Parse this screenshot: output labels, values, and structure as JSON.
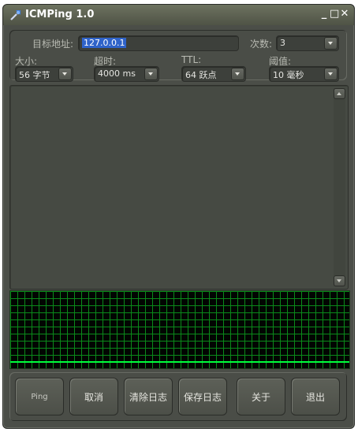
{
  "window": {
    "title": "ICMPing 1.0"
  },
  "titlebar": {
    "minimize": "_",
    "maximize": "□",
    "close": "✕"
  },
  "settings": {
    "target_label": "目标地址:",
    "target_value": "127.0.0.1",
    "count_label": "次数:",
    "count_value": "3",
    "size_label": "大小:",
    "size_value": "56 字节",
    "timeout_label": "超时:",
    "timeout_value": "4000 ms",
    "ttl_label": "TTL:",
    "ttl_value": "64 跃点",
    "threshold_label": "阈值:",
    "threshold_value": "10 毫秒"
  },
  "buttons": {
    "ping": "Ping",
    "cancel": "取消",
    "clear_log": "清除日志",
    "save_log": "保存日志",
    "about": "关于",
    "exit": "退出"
  },
  "colors": {
    "grid": "#0a8a1a",
    "graph_line": "#00ff3c",
    "selection": "#2f63c9"
  }
}
